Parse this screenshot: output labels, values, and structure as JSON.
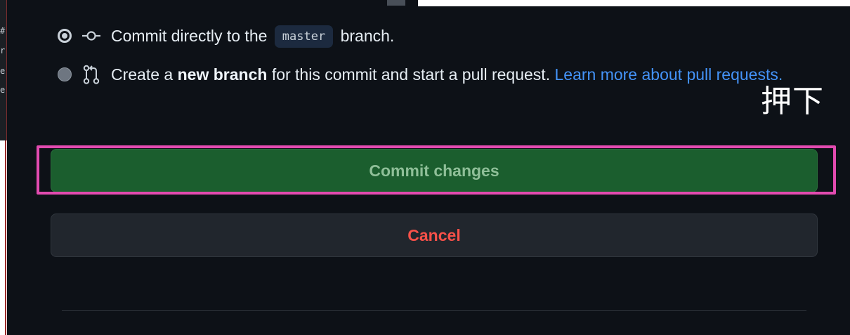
{
  "left_strip": {
    "fragments": [
      "#",
      "r",
      "e",
      "e"
    ]
  },
  "commit_options": {
    "direct": {
      "icon": "git-commit-icon",
      "text_before": "Commit directly to the",
      "branch": "master",
      "text_after": "branch.",
      "selected": true
    },
    "new_branch": {
      "icon": "git-pull-request-icon",
      "text_before": "Create a",
      "bold": "new branch",
      "text_after": "for this commit and start a pull request.",
      "link": "Learn more about pull requests.",
      "selected": false
    }
  },
  "annotation": {
    "text": "押下"
  },
  "buttons": {
    "commit": "Commit changes",
    "cancel": "Cancel"
  },
  "colors": {
    "panel_bg": "#0d1117",
    "commit_button": "#1b5e2e",
    "cancel_text": "#f85149",
    "link": "#4493f8",
    "highlight": "#e24bb0"
  }
}
